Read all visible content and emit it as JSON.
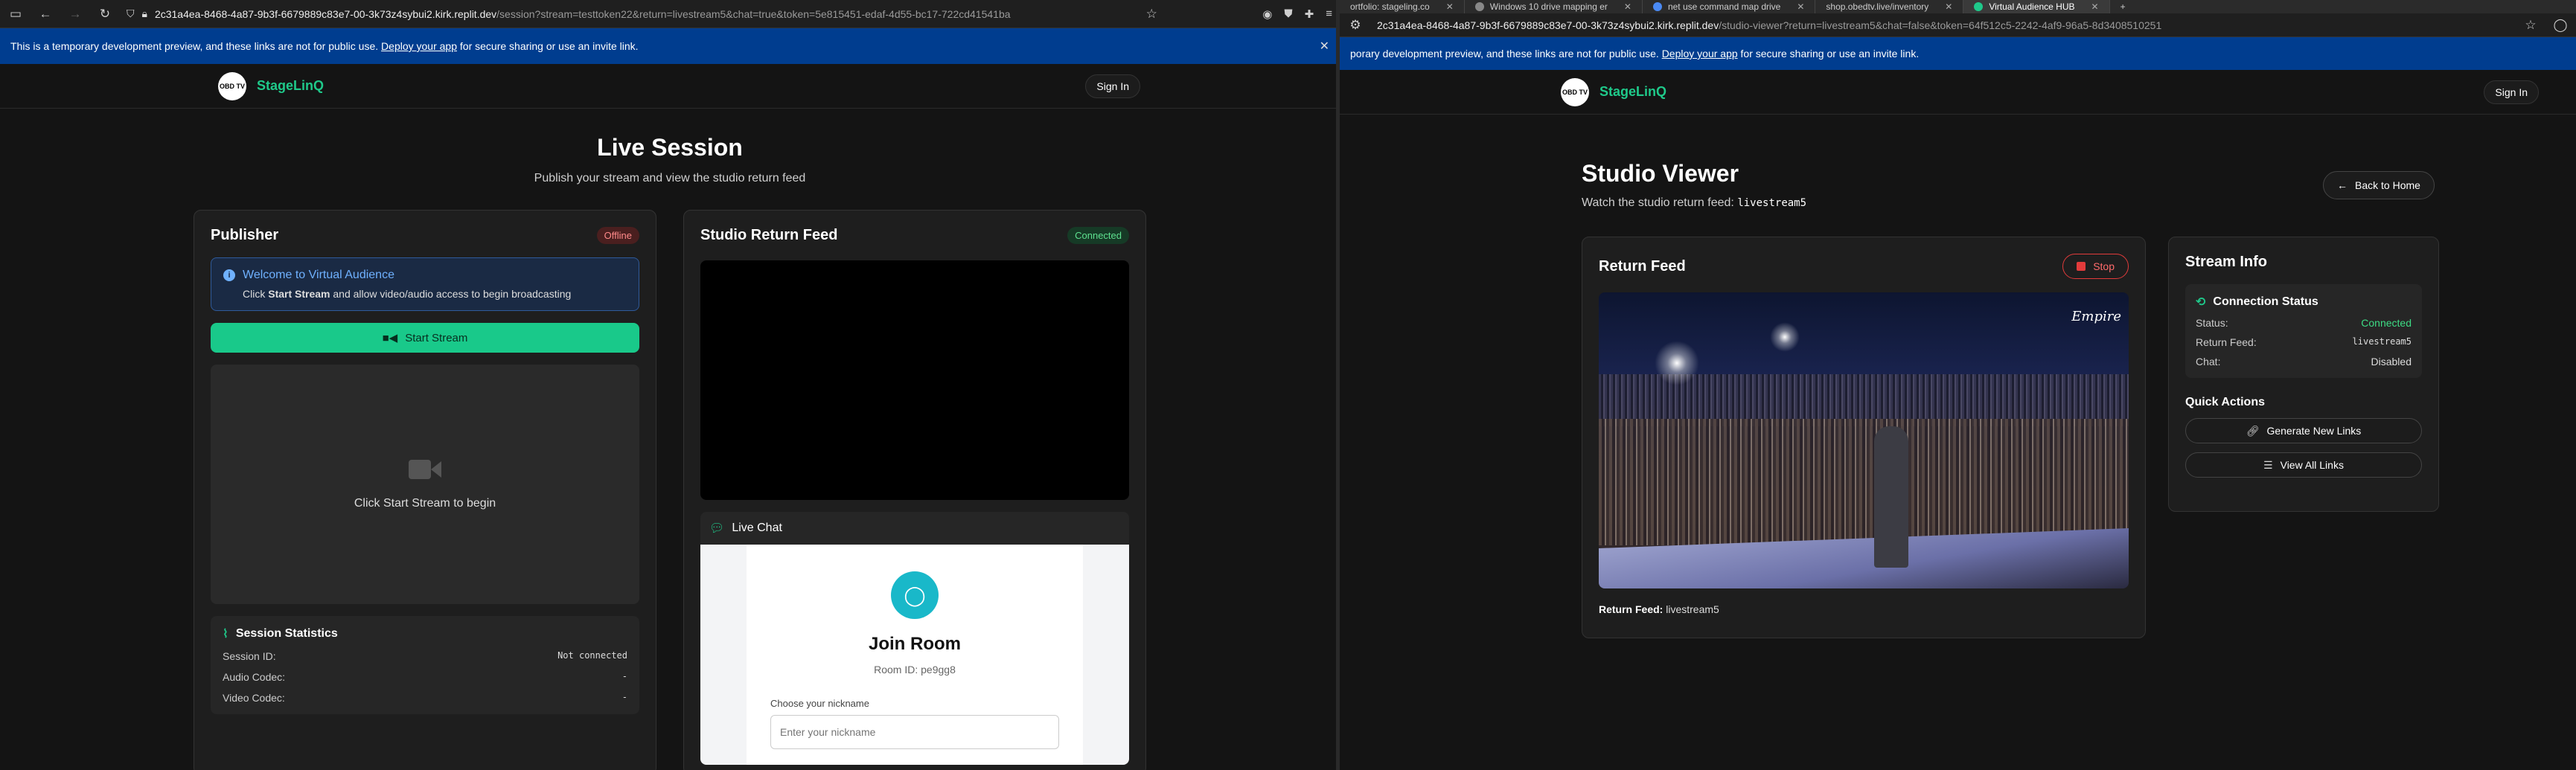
{
  "left": {
    "urlbar": {
      "host": "2c31a4ea-8468-4a87-9b3f-6679889c83e7-00-3k73z4sybui2.kirk.replit.dev",
      "path": "/session?stream=testtoken22&return=livestream5&chat=true&token=5e815451-edaf-4d55-bc17-722cd41541ba"
    },
    "banner": {
      "text": "This is a temporary development preview, and these links are not for public use.",
      "link": "Deploy your app",
      "suffix": "for secure sharing or use an invite link."
    },
    "nav": {
      "brand": "StageLinQ",
      "logo_text": "OBD TV",
      "signin": "Sign In"
    },
    "page": {
      "title": "Live Session",
      "subtitle": "Publish your stream and view the studio return feed"
    },
    "publisher": {
      "title": "Publisher",
      "status": "Offline",
      "welcome_title": "Welcome to Virtual Audience",
      "welcome_click": "Click",
      "welcome_bold": "Start Stream",
      "welcome_rest": "and allow video/audio access to begin broadcasting",
      "start_button": "Start Stream",
      "preview_text": "Click Start Stream to begin"
    },
    "stats": {
      "title": "Session Statistics",
      "rows": [
        {
          "label": "Session ID:",
          "value": "Not connected"
        },
        {
          "label": "Audio Codec:",
          "value": "-"
        },
        {
          "label": "Video Codec:",
          "value": "-"
        }
      ]
    },
    "return_feed": {
      "title": "Studio Return Feed",
      "status": "Connected",
      "chat_title": "Live Chat",
      "join_title": "Join Room",
      "room_id": "Room ID: pe9gg8",
      "nick_label": "Choose your nickname",
      "nick_placeholder": "Enter your nickname"
    }
  },
  "right": {
    "tabs": [
      {
        "label": "ortfolio: stageling.co"
      },
      {
        "label": "Windows 10 drive mapping er"
      },
      {
        "label": "net use command map drive"
      },
      {
        "label": "shop.obedtv.live/inventory"
      },
      {
        "label": "Virtual Audience HUB"
      }
    ],
    "urlbar": {
      "host": "2c31a4ea-8468-4a87-9b3f-6679889c83e7-00-3k73z4sybui2.kirk.replit.dev",
      "path": "/studio-viewer?return=livestream5&chat=false&token=64f512c5-2242-4af9-96a5-8d3408510251"
    },
    "banner": {
      "text": "porary development preview, and these links are not for public use.",
      "link": "Deploy your app",
      "suffix": "for secure sharing or use an invite link."
    },
    "nav": {
      "brand": "StageLinQ",
      "logo_text": "OBD TV",
      "signin": "Sign In"
    },
    "page": {
      "title": "Studio Viewer",
      "subtitle_prefix": "Watch the studio return feed:",
      "subtitle_code": "livestream5",
      "back": "Back to Home"
    },
    "return_feed": {
      "title": "Return Feed",
      "stop": "Stop",
      "feed_label": "Return Feed:",
      "feed_value": "livestream5",
      "watermark": "Empire"
    },
    "stream_info": {
      "title": "Stream Info",
      "conn_title": "Connection Status",
      "rows": [
        {
          "label": "Status:",
          "value": "Connected"
        },
        {
          "label": "Return Feed:",
          "value": "livestream5"
        },
        {
          "label": "Chat:",
          "value": "Disabled"
        }
      ],
      "quick_actions": "Quick Actions",
      "generate": "Generate New Links",
      "view_all": "View All Links"
    }
  },
  "colors": {
    "accent": "#1fc98a",
    "banner": "#003d8f",
    "danger": "#e23b3b",
    "connected": "#3ddc84"
  }
}
